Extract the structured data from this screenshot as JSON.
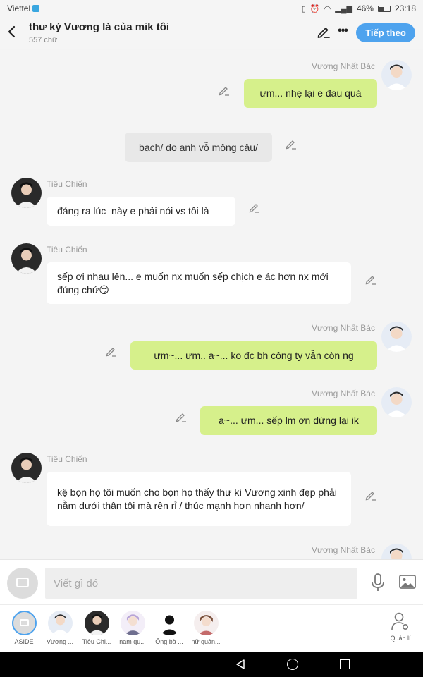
{
  "status": {
    "carrier": "Viettel",
    "battery": "46%",
    "time": "23:18"
  },
  "header": {
    "title": "thư ký Vương là của mik tôi",
    "subtitle": "557 chữ",
    "follow_label": "Tiếp theo"
  },
  "messages": [
    {
      "side": "right",
      "name": "Vương Nhất Bác",
      "text": "ưm... nhẹ lại e đau quá"
    },
    {
      "side": "narration",
      "text": "bạch/ do anh vỗ mông cậu/"
    },
    {
      "side": "left",
      "name": "Tiêu Chiến",
      "text": "đáng ra lúc  này e phải nói vs tôi là"
    },
    {
      "side": "left",
      "name": "Tiêu Chiến",
      "text": "sếp ơi nhau lên... e muốn nx muốn sếp chịch e ác hơn nx mới đúng chứ😏"
    },
    {
      "side": "right",
      "name": "Vương Nhất Bác",
      "text": "ưm~... ưm.. a~... ko đc bh công ty vẫn còn ng"
    },
    {
      "side": "right",
      "name": "Vương Nhất Bác",
      "text": "a~... ưm... sếp lm ơn dừng lại ik"
    },
    {
      "side": "left",
      "name": "Tiêu Chiến",
      "text": "kệ bọn họ tôi muốn cho bọn họ thấy thư kí Vương xinh đẹp phải nằm dưới thân tôi mà rên rỉ / thúc mạnh hơn nhanh hơn/"
    },
    {
      "side": "right",
      "name": "Vương Nhất Bác",
      "text": ""
    }
  ],
  "input": {
    "placeholder": "Viết gì đó"
  },
  "characters": [
    {
      "label": "ASIDE",
      "selected": true
    },
    {
      "label": "Vương ..."
    },
    {
      "label": "Tiêu Chi..."
    },
    {
      "label": "nam qu..."
    },
    {
      "label": "Ông bà ..."
    },
    {
      "label": "nữ quản..."
    }
  ],
  "manage_label": "Quản lí",
  "colors": {
    "accent": "#4ea3ee",
    "right_bubble": "#d6f08b",
    "left_bubble": "#ffffff",
    "narration_bubble": "#e8e8e8"
  },
  "icons": [
    "back-arrow-icon",
    "pencil-icon",
    "more-icon",
    "microphone-icon",
    "image-icon",
    "manage-user-icon"
  ]
}
